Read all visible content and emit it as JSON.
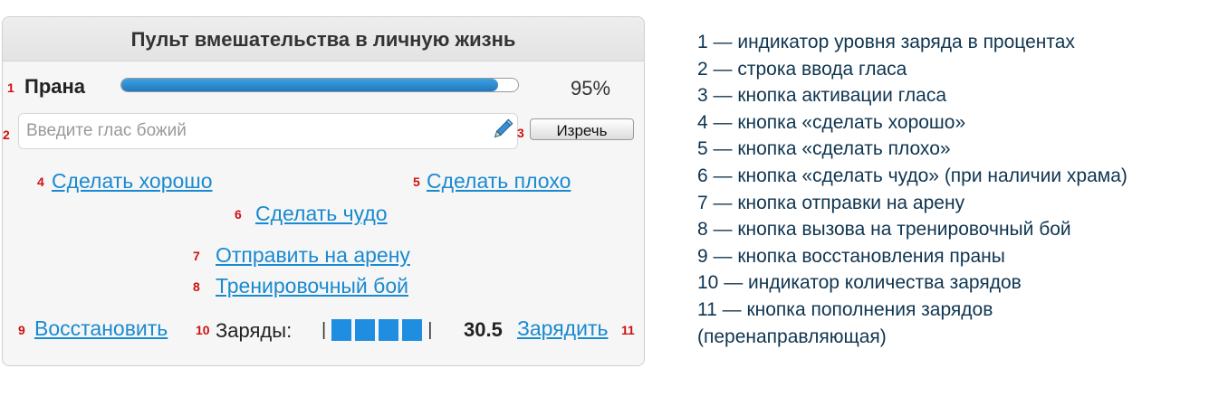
{
  "panel": {
    "title": "Пульт вмешательства в личную жизнь",
    "prana": {
      "label": "Прана",
      "level": 0.95,
      "percent_text": "95%"
    },
    "voice": {
      "placeholder": "Введите глас божий",
      "value": "",
      "submit_label": "Изречь"
    },
    "links": {
      "do_good": "Сделать хорошо",
      "do_bad": "Сделать плохо",
      "miracle": "Сделать чудо",
      "arena": "Отправить на арену",
      "training": "Тренировочный бой",
      "restore": "Восстановить",
      "recharge": "Зарядить"
    },
    "charges": {
      "label": "Заряды:",
      "left_bracket": "|",
      "right_bracket": "|",
      "filled_cells": 4,
      "value": "30.5"
    },
    "markers": [
      "1",
      "2",
      "3",
      "4",
      "5",
      "6",
      "7",
      "8",
      "9",
      "10",
      "11"
    ]
  },
  "legend": [
    "1 — индикатор уровня заряда в процентах",
    "2 — строка ввода гласа",
    "3 — кнопка активации гласа",
    "4 — кнопка «сделать хорошо»",
    "5 — кнопка «сделать плохо»",
    "6 — кнопка «сделать чудо» (при наличии храма)",
    "7 — кнопка отправки на арену",
    "8 — кнопка вызова на тренировочный бой",
    "9 — кнопка восстановления праны",
    "10 — индикатор количества зарядов",
    "11 — кнопка пополнения зарядов",
    "(перенаправляющая)"
  ],
  "colors": {
    "link": "#1a8ad0",
    "bar_fill": "#1f78c0",
    "marker": "#d01010",
    "legend_text": "#0f3550"
  },
  "icons": {
    "voice_submit": "pencil-icon"
  }
}
